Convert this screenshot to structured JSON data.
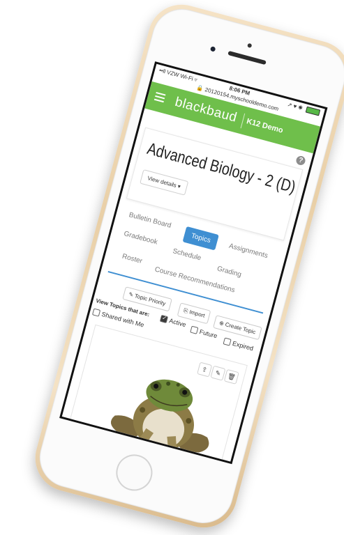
{
  "status_bar": {
    "carrier": "••ll VZW Wi-Fi ▿",
    "time": "8:06 PM",
    "url": "🔒 20120154.myschooldemo.com",
    "indicators": "↗ ♥ ✱"
  },
  "header": {
    "brand": "blackbaud",
    "product": "K12 Demo"
  },
  "course": {
    "title": "Advanced Biology - 2 (D)",
    "view_details": "View details ▾"
  },
  "tabs": {
    "bulletin_board": "Bulletin Board",
    "topics": "Topics",
    "assignments": "Assignments",
    "gradebook": "Gradebook",
    "schedule": "Schedule",
    "grading": "Grading",
    "roster": "Roster",
    "course_recommendations": "Course Recommendations",
    "active": "Topics"
  },
  "toolbar": {
    "topic_priority": "✎ Topic Priority",
    "import": "⎘ Import",
    "create_topic": "⊕ Create Topic"
  },
  "filters": {
    "label": "View Topics that are:",
    "active": "Active",
    "future": "Future",
    "expired": "Expired",
    "shared": "Shared with Me",
    "active_checked": true,
    "future_checked": false,
    "expired_checked": false,
    "shared_checked": false
  },
  "topic_card": {
    "share_icon": "share-icon",
    "edit_icon": "pencil-icon",
    "delete_icon": "trash-icon"
  },
  "colors": {
    "header_green": "#6fbf4b",
    "accent_blue": "#3f8fd2",
    "phone_gold": "#e9cfa6"
  }
}
